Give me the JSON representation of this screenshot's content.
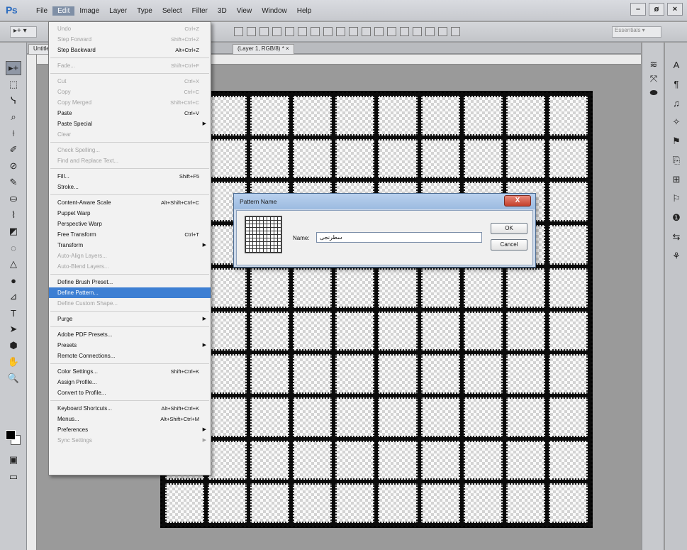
{
  "app": {
    "logo": "Ps"
  },
  "menubar": {
    "items": [
      "File",
      "Edit",
      "Image",
      "Layer",
      "Type",
      "Select",
      "Filter",
      "3D",
      "View",
      "Window",
      "Help"
    ],
    "active": "Edit"
  },
  "window_controls": {
    "minimize": "–",
    "restore": "ø",
    "close": "×"
  },
  "optbar": {
    "tool_preset": "▸+ ▾",
    "workspace": "Essentials ▾"
  },
  "document_tabs": [
    "Untitled",
    "(Layer 1, RGB/8) *  ×"
  ],
  "edit_menu": {
    "groups": [
      [
        {
          "label": "Undo",
          "shortcut": "Ctrl+Z",
          "disabled": true
        },
        {
          "label": "Step Forward",
          "shortcut": "Shift+Ctrl+Z",
          "disabled": true
        },
        {
          "label": "Step Backward",
          "shortcut": "Alt+Ctrl+Z",
          "disabled": false
        }
      ],
      [
        {
          "label": "Fade...",
          "shortcut": "Shift+Ctrl+F",
          "disabled": true
        }
      ],
      [
        {
          "label": "Cut",
          "shortcut": "Ctrl+X",
          "disabled": true
        },
        {
          "label": "Copy",
          "shortcut": "Ctrl+C",
          "disabled": true
        },
        {
          "label": "Copy Merged",
          "shortcut": "Shift+Ctrl+C",
          "disabled": true
        },
        {
          "label": "Paste",
          "shortcut": "Ctrl+V",
          "disabled": false
        },
        {
          "label": "Paste Special",
          "shortcut": "",
          "submenu": true,
          "disabled": false
        },
        {
          "label": "Clear",
          "shortcut": "",
          "disabled": true
        }
      ],
      [
        {
          "label": "Check Spelling...",
          "shortcut": "",
          "disabled": true
        },
        {
          "label": "Find and Replace Text...",
          "shortcut": "",
          "disabled": true
        }
      ],
      [
        {
          "label": "Fill...",
          "shortcut": "Shift+F5",
          "disabled": false
        },
        {
          "label": "Stroke...",
          "shortcut": "",
          "disabled": false
        }
      ],
      [
        {
          "label": "Content-Aware Scale",
          "shortcut": "Alt+Shift+Ctrl+C",
          "disabled": false
        },
        {
          "label": "Puppet Warp",
          "shortcut": "",
          "disabled": false
        },
        {
          "label": "Perspective Warp",
          "shortcut": "",
          "disabled": false
        },
        {
          "label": "Free Transform",
          "shortcut": "Ctrl+T",
          "disabled": false
        },
        {
          "label": "Transform",
          "shortcut": "",
          "submenu": true,
          "disabled": false
        },
        {
          "label": "Auto-Align Layers...",
          "shortcut": "",
          "disabled": true
        },
        {
          "label": "Auto-Blend Layers...",
          "shortcut": "",
          "disabled": true
        }
      ],
      [
        {
          "label": "Define Brush Preset...",
          "shortcut": "",
          "disabled": false
        },
        {
          "label": "Define Pattern...",
          "shortcut": "",
          "disabled": false,
          "highlight": true
        },
        {
          "label": "Define Custom Shape...",
          "shortcut": "",
          "disabled": true
        }
      ],
      [
        {
          "label": "Purge",
          "shortcut": "",
          "submenu": true,
          "disabled": false
        }
      ],
      [
        {
          "label": "Adobe PDF Presets...",
          "shortcut": "",
          "disabled": false
        },
        {
          "label": "Presets",
          "shortcut": "",
          "submenu": true,
          "disabled": false
        },
        {
          "label": "Remote Connections...",
          "shortcut": "",
          "disabled": false
        }
      ],
      [
        {
          "label": "Color Settings...",
          "shortcut": "Shift+Ctrl+K",
          "disabled": false
        },
        {
          "label": "Assign Profile...",
          "shortcut": "",
          "disabled": false
        },
        {
          "label": "Convert to Profile...",
          "shortcut": "",
          "disabled": false
        }
      ],
      [
        {
          "label": "Keyboard Shortcuts...",
          "shortcut": "Alt+Shift+Ctrl+K",
          "disabled": false
        },
        {
          "label": "Menus...",
          "shortcut": "Alt+Shift+Ctrl+M",
          "disabled": false
        },
        {
          "label": "Preferences",
          "shortcut": "",
          "submenu": true,
          "disabled": false
        },
        {
          "label": "Sync Settings",
          "shortcut": "",
          "submenu": true,
          "disabled": true
        }
      ]
    ]
  },
  "dialog": {
    "title": "Pattern Name",
    "close": "X",
    "name_label": "Name:",
    "name_value": "سطرنجی",
    "ok": "OK",
    "cancel": "Cancel"
  },
  "tools": [
    "▸+",
    "⬚",
    "ᓭ",
    "⌕",
    "⟊",
    "✐",
    "⊘",
    "✎",
    "⛀",
    "⌇",
    "◩",
    "◌",
    "△",
    "●",
    "⊿",
    "T",
    "➤",
    "⬢",
    "✋",
    "🔍"
  ],
  "dock_mid_icons": [
    "≋",
    "⤧",
    "⬬"
  ],
  "dock_right_icons": [
    "A",
    "¶",
    "♫",
    "✧",
    "⚑",
    "⎘",
    "⊞",
    "⚐",
    "❶",
    "⇆",
    "⚘"
  ],
  "canvas": {
    "rows": 10,
    "cols": 10
  }
}
